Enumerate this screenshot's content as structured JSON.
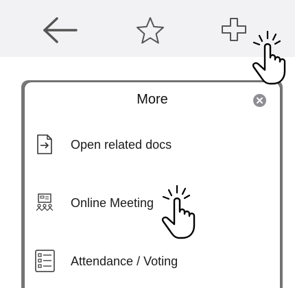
{
  "toolbar": {
    "back_icon": "arrow-left-icon",
    "favorite_icon": "star-icon",
    "add_icon": "plus-icon"
  },
  "popup": {
    "title": "More",
    "close_icon": "close-circle-icon",
    "items": [
      {
        "label": "Open related docs",
        "icon": "open-document-icon"
      },
      {
        "label": "Online Meeting",
        "icon": "meeting-icon"
      },
      {
        "label": "Attendance / Voting",
        "icon": "list-icon"
      }
    ]
  },
  "overlay": {
    "pointer_icon": "tap-hand-icon"
  },
  "colors": {
    "toolbar_bg": "#f2f2f4",
    "icon_stroke": "#555555",
    "popup_bg": "#ffffff",
    "close_bg": "#8e8e93"
  }
}
